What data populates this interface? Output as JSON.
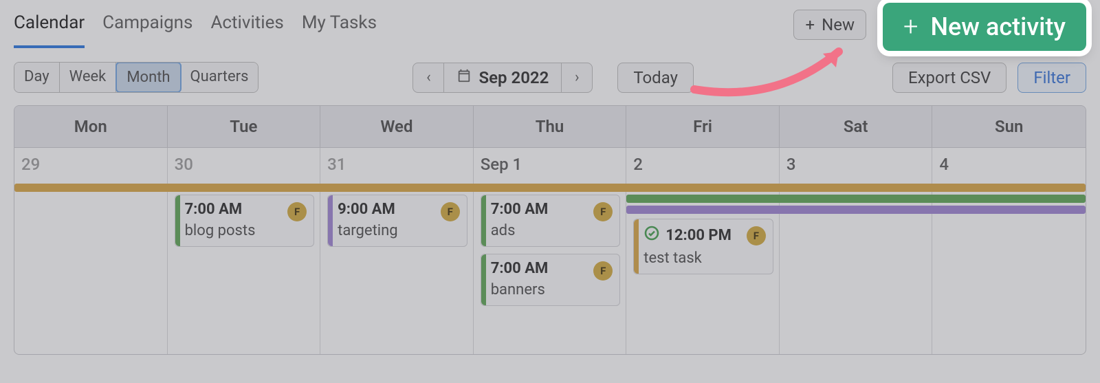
{
  "tabs": {
    "calendar": "Calendar",
    "campaigns": "Campaigns",
    "activities": "Activities",
    "my_tasks": "My Tasks"
  },
  "range_buttons": {
    "day": "Day",
    "week": "Week",
    "month": "Month",
    "quarters": "Quarters"
  },
  "month_nav": {
    "label": "Sep 2022",
    "today": "Today"
  },
  "right_buttons": {
    "new_dropdown": "New",
    "export": "Export CSV",
    "filter": "Filter"
  },
  "popup": {
    "new_activity": "New activity"
  },
  "weekdays": [
    "Mon",
    "Tue",
    "Wed",
    "Thu",
    "Fri",
    "Sat",
    "Sun"
  ],
  "dates": [
    "29",
    "30",
    "31",
    "Sep 1",
    "2",
    "3",
    "4"
  ],
  "events": {
    "tue": {
      "time": "7:00 AM",
      "title": "blog posts"
    },
    "wed": {
      "time": "9:00 AM",
      "title": "targeting"
    },
    "thu1": {
      "time": "7:00 AM",
      "title": "ads"
    },
    "thu2": {
      "time": "7:00 AM",
      "title": "banners"
    },
    "fri": {
      "time": "12:00 PM",
      "title": "test task"
    }
  },
  "avatar_letter": "F",
  "colors": {
    "primary": "#1f6fde",
    "green": "#3aa57b",
    "orange_bar": "#d7a23b",
    "green_bar": "#57a24e",
    "purple_bar": "#9a7fd1",
    "pink_arrow": "#f27288"
  }
}
